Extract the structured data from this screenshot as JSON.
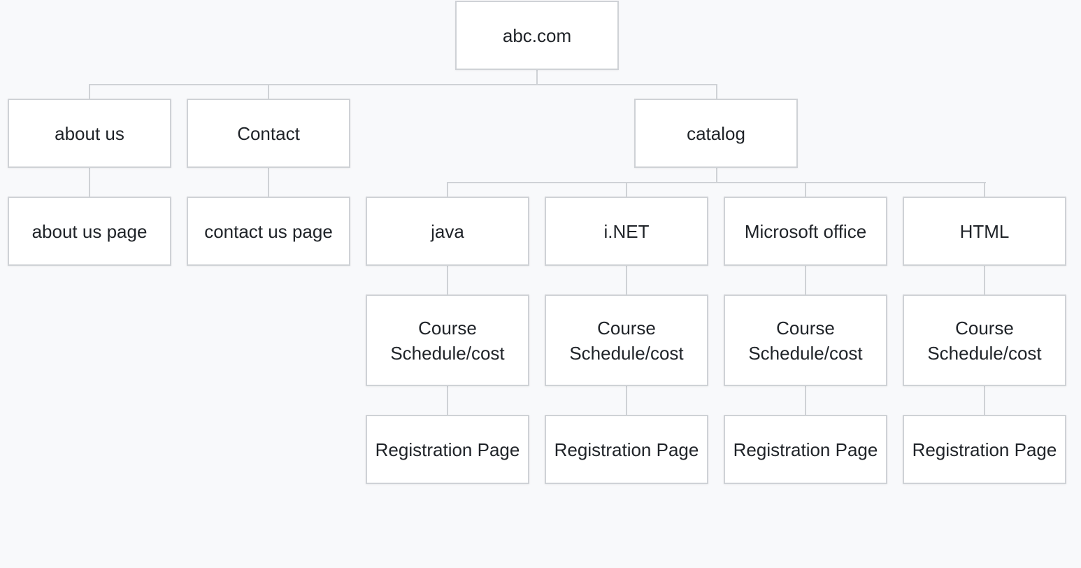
{
  "diagram": {
    "root": {
      "label": "abc.com"
    },
    "about": {
      "label": "about us",
      "child": "about us page"
    },
    "contact": {
      "label": "Contact",
      "child": "contact us page"
    },
    "catalog": {
      "label": "catalog",
      "courses": [
        {
          "label": "java",
          "schedule": "Course Schedule/cost",
          "registration": "Registration Page"
        },
        {
          "label": "i.NET",
          "schedule": "Course Schedule/cost",
          "registration": "Registration Page"
        },
        {
          "label": "Microsoft office",
          "schedule": "Course Schedule/cost",
          "registration": "Registration Page"
        },
        {
          "label": "HTML",
          "schedule": "Course Schedule/cost",
          "registration": "Registration Page"
        }
      ]
    }
  }
}
